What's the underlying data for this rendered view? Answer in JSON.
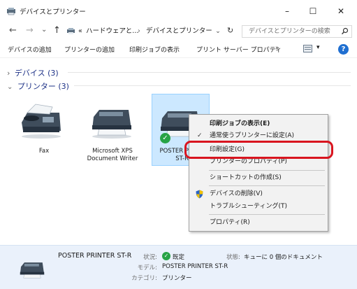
{
  "window": {
    "title": "デバイスとプリンター",
    "minimize": "–",
    "maximize": "☐",
    "close": "✕"
  },
  "address": {
    "back": "←",
    "forward": "→",
    "recent": "⌄",
    "up": "↑",
    "prefix": "«",
    "crumb1": "ハードウェアと...",
    "separator": "›",
    "crumb2": "デバイスとプリンター",
    "dropdown": "⌄",
    "refresh": "↻",
    "search_placeholder": "デバイスとプリンターの検索"
  },
  "toolbar": {
    "add_device": "デバイスの追加",
    "add_printer": "プリンターの追加",
    "view_print_jobs": "印刷ジョブの表示",
    "print_server_props": "プリント サーバー プロパティ",
    "more": "»",
    "view_dropdown": "▾",
    "help": "?"
  },
  "groups": {
    "devices": {
      "chevron": "›",
      "label": "デバイス (3)"
    },
    "printers": {
      "chevron": "⌄",
      "label": "プリンター (3)"
    }
  },
  "printers": [
    {
      "name": "Fax"
    },
    {
      "name_line1": "Microsoft XPS",
      "name_line2": "Document Writer"
    },
    {
      "name_line1": "POSTER P",
      "name_line2": "ST-R",
      "default_check": "✓"
    }
  ],
  "context_menu": {
    "items": [
      {
        "label": "印刷ジョブの表示(E)"
      },
      {
        "label": "通常使うプリンターに設定(A)",
        "check": "✓"
      },
      {
        "label": "印刷設定(G)"
      },
      {
        "label": "プリンターのプロパティ(P)"
      },
      {
        "label": "ショートカットの作成(S)"
      },
      {
        "label": "デバイスの削除(V)"
      },
      {
        "label": "トラブルシューティング(T)"
      },
      {
        "label": "プロパティ(R)"
      }
    ]
  },
  "details": {
    "name": "POSTER PRINTER ST-R",
    "status_label": "状況:",
    "status_check": "✓",
    "status_value": "既定",
    "state_label": "状態:",
    "state_value": "キューに 0 個のドキュメント",
    "model_label": "モデル:",
    "model_value": "POSTER PRINTER ST-R",
    "category_label": "カテゴリ:",
    "category_value": "プリンター"
  },
  "colors": {
    "accent_blue": "#0067c0",
    "selection_bg": "#cce8ff",
    "highlight_red": "#d9151f",
    "success_green": "#27a346"
  }
}
